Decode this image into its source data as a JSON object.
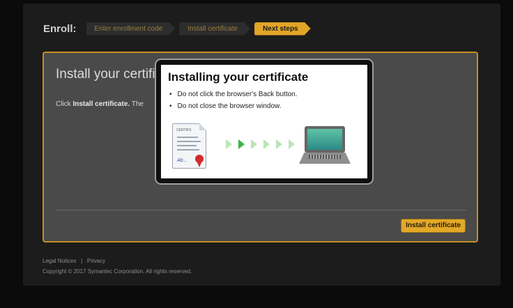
{
  "enroll": {
    "label": "Enroll:",
    "steps": [
      {
        "label": "Enter enrollment code",
        "state": "inactive"
      },
      {
        "label": "Install certificate",
        "state": "inactive"
      },
      {
        "label": "Next steps",
        "state": "active"
      }
    ]
  },
  "panel": {
    "title": "Install your certificate",
    "text_prefix": "Click ",
    "text_bold": "Install certificate.",
    "text_suffix": " The",
    "install_button": "Install certificate"
  },
  "modal": {
    "title": "Installing your certificate",
    "items": [
      "Do not click the browser's Back button.",
      "Do not close the browser window."
    ],
    "cert_head": "CERTIFS",
    "cert_sig": "Ab..."
  },
  "footer": {
    "links": "Legal Notices   |   Privacy",
    "copyright": "Copyright © 2017 Symantec Corporation. All rights reserved."
  },
  "colors": {
    "accent": "#e2a525",
    "panel_border": "#c4911f",
    "background": "#0b0b0b"
  }
}
